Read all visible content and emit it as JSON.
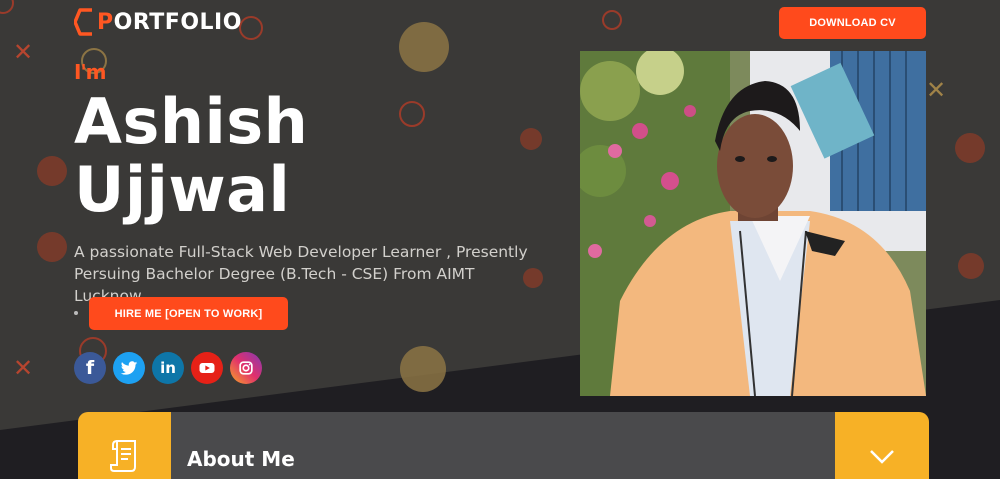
{
  "header": {
    "logo": {
      "accent": "P",
      "rest": "ORTFOLIO",
      "icon": "hexagon-logo-icon"
    },
    "download_cv_label": "DOWNLOAD CV"
  },
  "hero": {
    "greeting": "I'm",
    "name_first": "Ashish",
    "name_last": "Ujjwal",
    "description_line1": "A passionate Full-Stack Web Developer Learner , Presently",
    "description_line2": "Persuing Bachelor Degree (B.Tech - CSE) From AIMT Lucknow.",
    "hire_label": "HIRE ME [OPEN TO WORK]"
  },
  "socials": [
    {
      "name": "facebook",
      "glyph": "f",
      "color": "#3b5998"
    },
    {
      "name": "twitter",
      "glyph": "",
      "color": "#1da1f2"
    },
    {
      "name": "linkedin",
      "glyph": "in",
      "color": "#0e76a8"
    },
    {
      "name": "youtube",
      "glyph": "",
      "color": "#e62117"
    },
    {
      "name": "instagram",
      "glyph": "",
      "color": "#c13584"
    }
  ],
  "about": {
    "title": "About Me",
    "icon": "document-scroll-icon",
    "toggle_icon": "chevron-down-icon"
  },
  "colors": {
    "accent": "#ff4a1c",
    "card_accent": "#f7b126",
    "background": "#3a3937",
    "background_dark": "#1f1e22"
  }
}
